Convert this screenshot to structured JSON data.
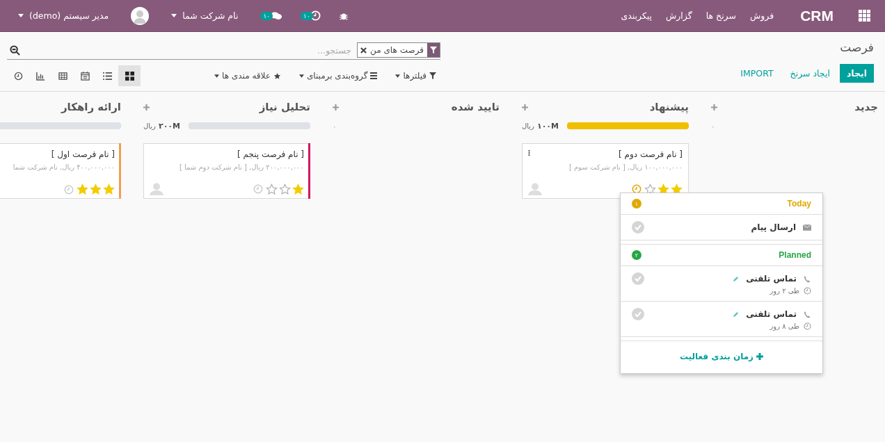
{
  "navbar": {
    "brand": "CRM",
    "menu": [
      "فروش",
      "سرنخ ها",
      "گزارش",
      "پیکربندی"
    ],
    "activity_badge": "۱۰",
    "chat_badge": "۱۰",
    "company": "نام شرکت شما",
    "user": "مدیر سیستم (demo)"
  },
  "breadcrumb": "فرصت",
  "search": {
    "facet": "فرصت های من",
    "placeholder": "جستجو..."
  },
  "buttons": [
    {
      "label": "ایجاد",
      "kind": "primary"
    },
    {
      "label": "ایجاد سرنخ",
      "kind": "link"
    },
    {
      "label": "IMPORT",
      "kind": "link"
    }
  ],
  "filters": [
    {
      "label": "فیلترها",
      "kind": "filter"
    },
    {
      "label": "گروه‌بندی برمبنای",
      "kind": "group"
    },
    {
      "label": "علاقه مندی ها",
      "kind": "favorite"
    }
  ],
  "views": [
    {
      "kind": "kanban",
      "selected": true
    },
    {
      "kind": "list",
      "selected": false
    },
    {
      "kind": "calendar",
      "selected": false
    },
    {
      "kind": "pivot",
      "selected": false
    },
    {
      "kind": "graph",
      "selected": false
    },
    {
      "kind": "activity",
      "selected": false
    }
  ],
  "columns": [
    {
      "title": "جدید",
      "count": "۰"
    },
    {
      "title": "پیشنهاد",
      "total": "۱۰۰M",
      "currency": "ریال",
      "progress": {
        "level": 1,
        "color": "#f0c000"
      },
      "cards": [
        {
          "title": "[ نام فرصت دوم ]",
          "subtitle": "۱۰۰,۰۰۰,۰۰۰ ریال, [ نام شرکت سوم ]",
          "stars": 2,
          "activity_today": true,
          "menu": true,
          "avatar": true
        }
      ]
    },
    {
      "title": "تایید شده",
      "count": "۰"
    },
    {
      "title": "تحلیل نیاز",
      "total": "۲۰۰M",
      "currency": "ریال",
      "progress": {
        "level": 0
      },
      "cards": [
        {
          "title": "[ نام فرصت پنجم ]",
          "subtitle": "۲۰۰,۰۰۰,۰۰۰ ریال, [ نام شرکت دوم شما ]",
          "stars": 1,
          "activity_today": false,
          "color": "#d6145f",
          "menu": false,
          "avatar": true
        }
      ]
    },
    {
      "title": "ارائه راهکار",
      "progress": {
        "level": 0
      },
      "cards": [
        {
          "title": "[ نام فرصت اول ]",
          "subtitle": "۴۰۰,۰۰۰,۰۰۰ ریال, نام شرکت شما",
          "stars": 3,
          "activity_today": false,
          "color": "#f0a050",
          "menu": false,
          "avatar": false
        }
      ]
    }
  ],
  "activity_popup": {
    "groups": [
      {
        "label": "Today",
        "kind": "today",
        "count": "۱",
        "items": [
          {
            "title": "ارسال پیام",
            "kind": "email",
            "editable": false
          }
        ]
      },
      {
        "label": "Planned",
        "kind": "planned",
        "count": "۲",
        "items": [
          {
            "title": "تماس تلفنی",
            "kind": "call",
            "editable": true,
            "due": "طی ۲ روز"
          },
          {
            "title": "تماس تلفنی",
            "kind": "call",
            "editable": true,
            "due": "طی ۸ روز"
          }
        ]
      }
    ],
    "footer": "زمان بندی فعالیت"
  }
}
